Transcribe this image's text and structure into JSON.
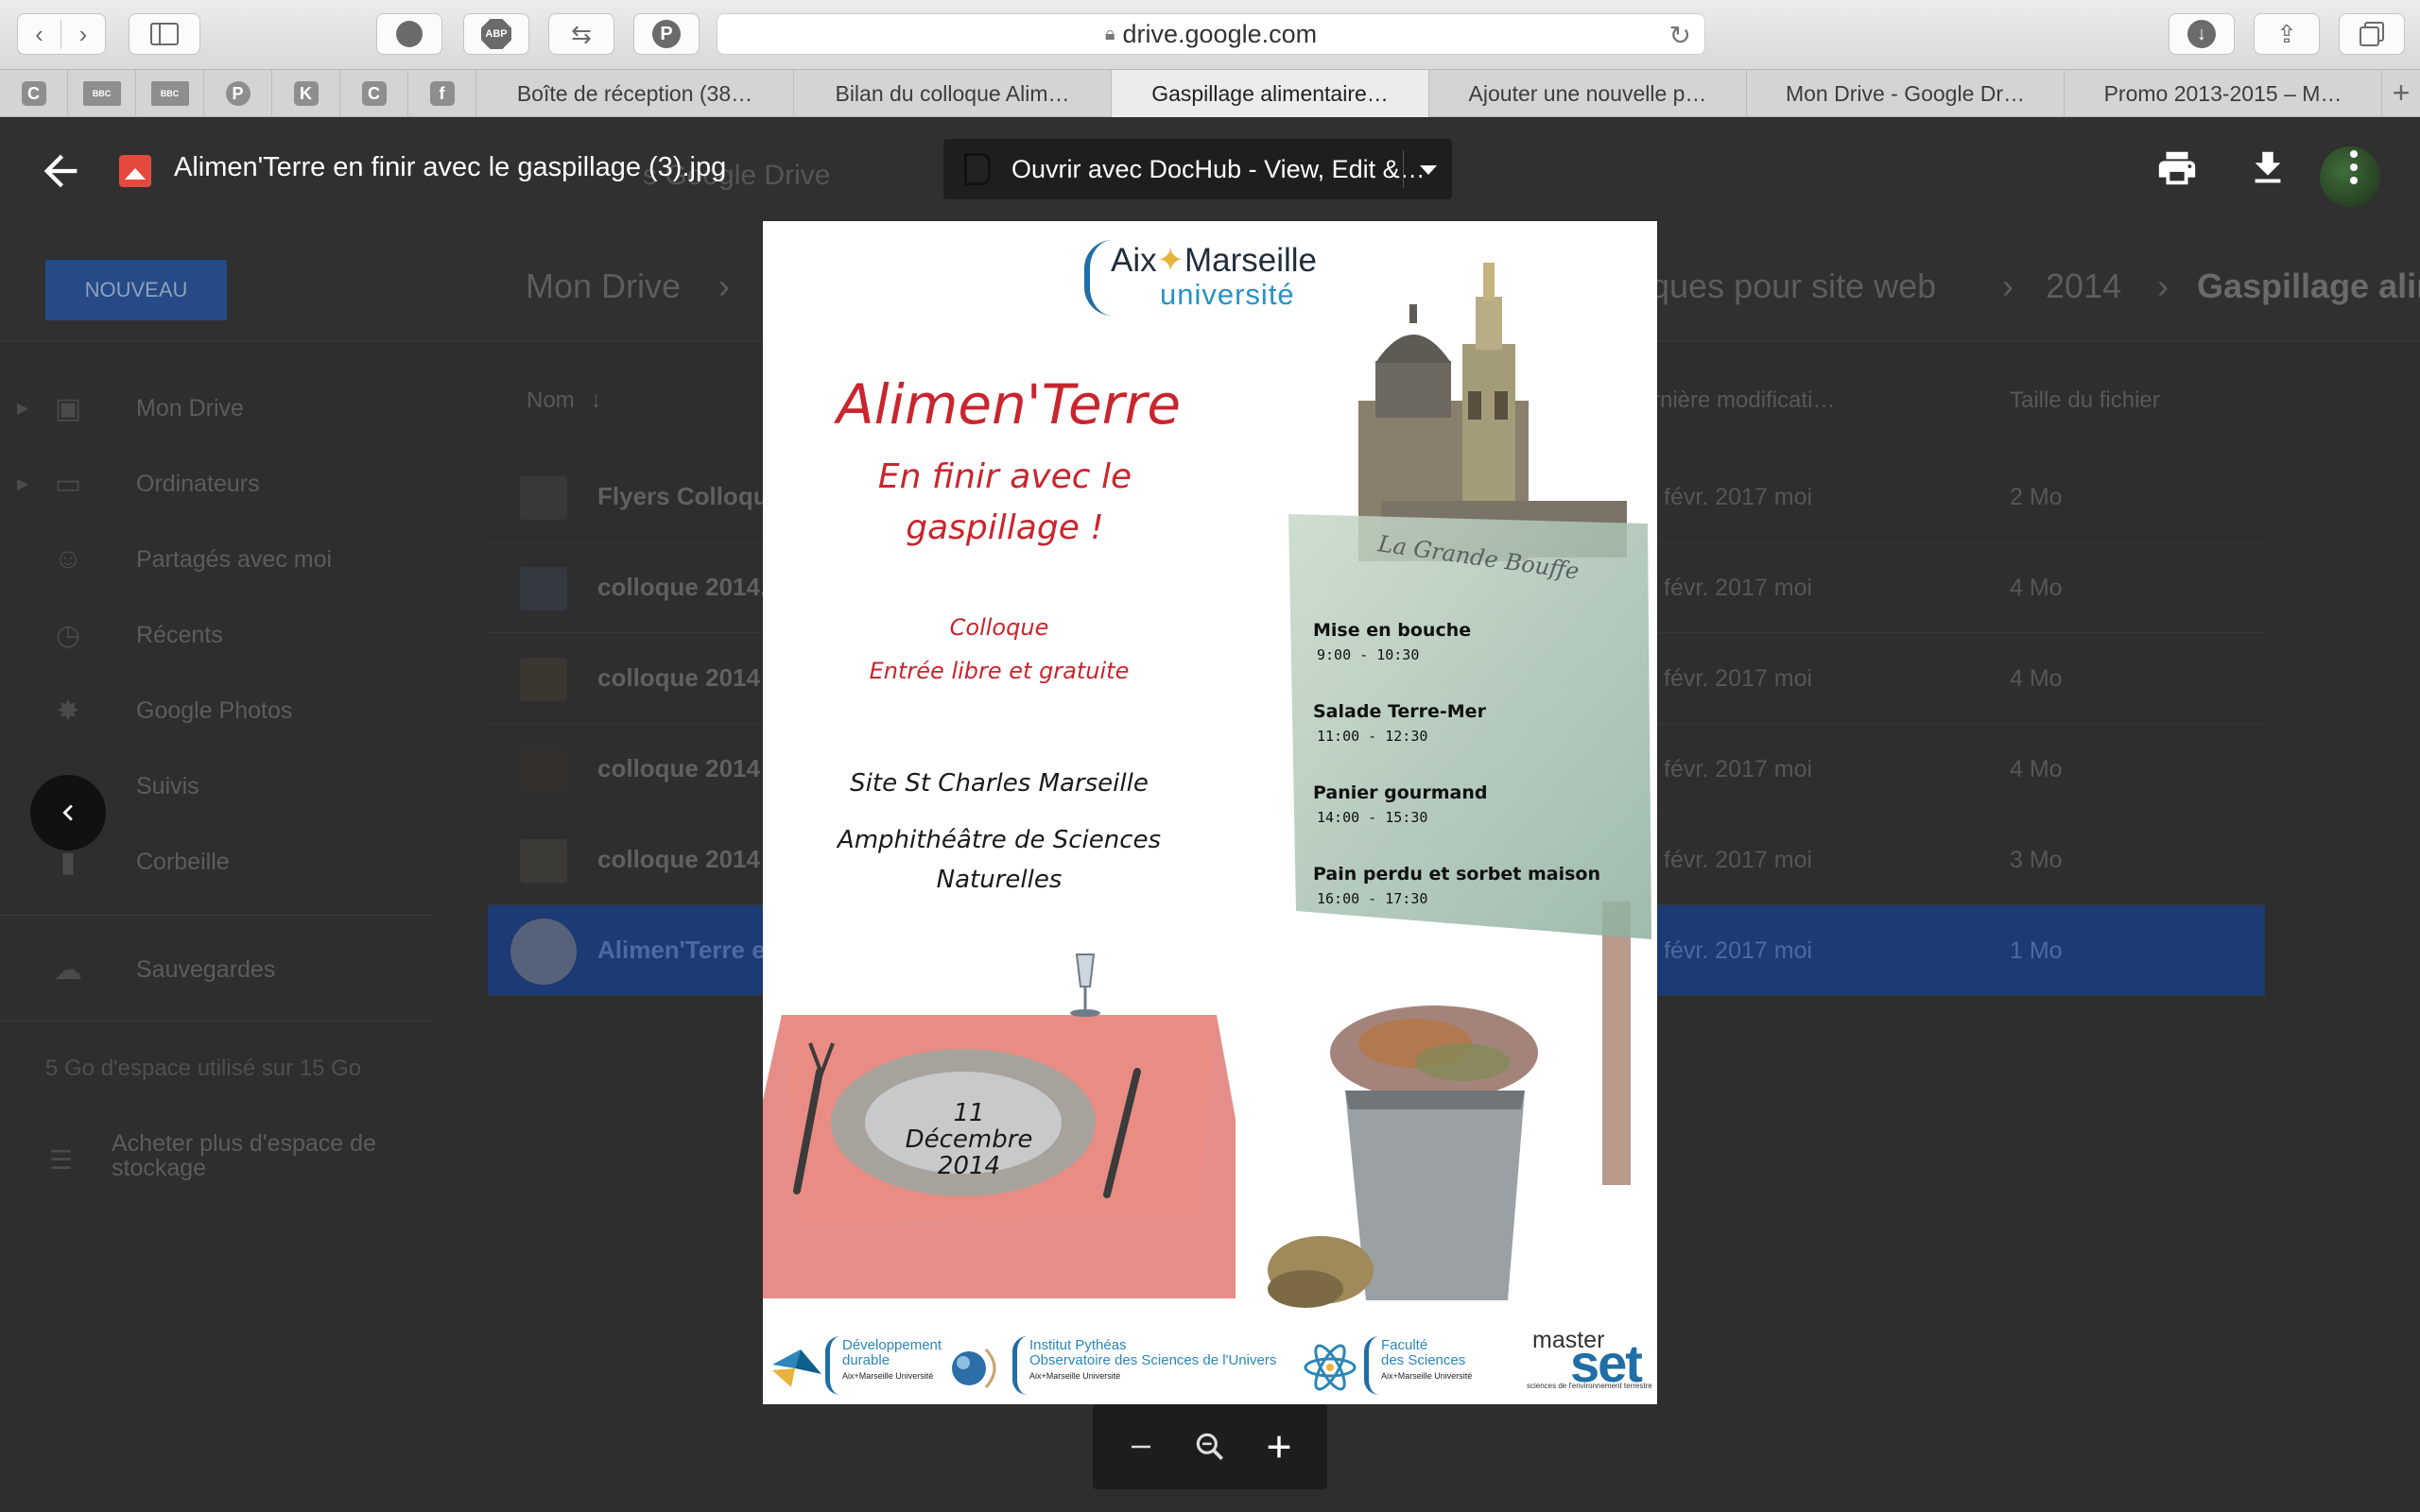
{
  "browser": {
    "url": "drive.google.com",
    "tabs": [
      {
        "label": "Boîte de réception (38…",
        "active": false
      },
      {
        "label": "Bilan du colloque Alim…",
        "active": false
      },
      {
        "label": "Gaspillage alimentaire…",
        "active": true
      },
      {
        "label": "Ajouter une nouvelle p…",
        "active": false
      },
      {
        "label": "Mon Drive - Google Dr…",
        "active": false
      },
      {
        "label": "Promo 2013-2015 – M…",
        "active": false
      }
    ],
    "pinned": [
      "C",
      "BBC",
      "BBC",
      "P",
      "K",
      "C",
      "f"
    ]
  },
  "drive": {
    "search_placeholder": "s Google Drive",
    "new_button": "NOUVEAU",
    "breadcrumb": [
      "Mon Drive",
      "ques pour site web",
      "2014",
      "Gaspillage alin"
    ],
    "sidebar": [
      {
        "label": "Mon Drive",
        "icon": "drive-icon"
      },
      {
        "label": "Ordinateurs",
        "icon": "computers-icon"
      },
      {
        "label": "Partagés avec moi",
        "icon": "shared-icon"
      },
      {
        "label": "Récents",
        "icon": "clock-icon"
      },
      {
        "label": "Google Photos",
        "icon": "photos-icon"
      },
      {
        "label": "Suivis",
        "icon": "star-icon"
      },
      {
        "label": "Corbeille",
        "icon": "trash-icon"
      },
      {
        "label": "Sauvegardes",
        "icon": "cloud-icon"
      }
    ],
    "storage_text": "5 Go d'espace utilisé sur 15 Go",
    "buy_storage": "Acheter plus d'espace de stockage",
    "columns": {
      "name": "Nom",
      "modified": "rnière modificati…",
      "size": "Taille du fichier"
    },
    "files": [
      {
        "name": "Flyers Colloque",
        "modified": "févr. 2017  moi",
        "size": "2 Mo",
        "selected": false
      },
      {
        "name": "colloque 2014.",
        "modified": "févr. 2017  moi",
        "size": "4 Mo",
        "selected": false
      },
      {
        "name": "colloque 2014",
        "modified": "févr. 2017  moi",
        "size": "4 Mo",
        "selected": false
      },
      {
        "name": "colloque 2014",
        "modified": "févr. 2017  moi",
        "size": "4 Mo",
        "selected": false
      },
      {
        "name": "colloque 2014",
        "modified": "févr. 2017  moi",
        "size": "3 Mo",
        "selected": false
      },
      {
        "name": "Alimen'Terre en",
        "modified": "févr. 2017  moi",
        "size": "1 Mo",
        "selected": true
      }
    ]
  },
  "viewer": {
    "file_title": "Alimen'Terre en finir avec le gaspillage (3).jpg",
    "open_with": "Ouvrir avec DocHub - View, Edit &…"
  },
  "poster": {
    "logo_name_left": "Aix",
    "logo_name_right": "Marseille",
    "logo_sub": "université",
    "title": "Alimen'Terre",
    "subtitle_line1": "En finir avec le",
    "subtitle_line2": "gaspillage !",
    "event_type": "Colloque",
    "entry": "Entrée libre et gratuite",
    "venue_line1": "Site St Charles Marseille",
    "venue_line2": "Amphithéâtre de Sciences",
    "venue_line3": "Naturelles",
    "sign_script": "La Grande Bouffe",
    "menu": [
      {
        "name": "Mise en bouche",
        "time": "9:00 - 10:30"
      },
      {
        "name": "Salade Terre-Mer",
        "time": "11:00 - 12:30"
      },
      {
        "name": "Panier gourmand",
        "time": "14:00 - 15:30"
      },
      {
        "name": "Pain perdu et sorbet maison",
        "time": "16:00 - 17:30"
      }
    ],
    "date_day": "11",
    "date_month": "Décembre",
    "date_year": "2014",
    "partners": {
      "dd_line1": "Développement",
      "dd_line2": "durable",
      "amu_small": "Aix+Marseille Université",
      "pytheas_line1": "Institut Pythéas",
      "pytheas_line2": "Observatoire des Sciences de l'Univers",
      "faculte_line1": "Faculté",
      "faculte_line2": "des Sciences",
      "master": "master",
      "set": "set",
      "set_caption": "sciences de l'environnement terrestre"
    }
  }
}
